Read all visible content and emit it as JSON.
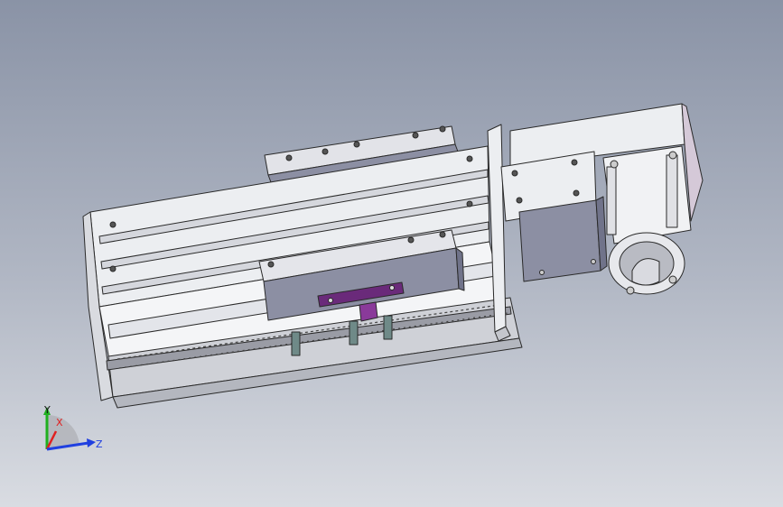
{
  "triad": {
    "x_label": "X",
    "y_label": "Y",
    "z_label": "Z",
    "x_color": "#e02020",
    "y_color": "#20b020",
    "z_color": "#2040e0"
  },
  "model": {
    "frame_color": "#e9eaee",
    "slot_color": "#d5d7dd",
    "carriage_color": "#8c8fa3",
    "bracket_color": "#6a2a7a",
    "motor_color": "#c9cbd2",
    "edge_color": "#2a2a2a"
  }
}
